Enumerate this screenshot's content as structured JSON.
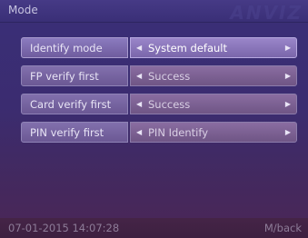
{
  "header": {
    "title": "Mode",
    "brand": "ANVIZ"
  },
  "settings": [
    {
      "label": "Identify mode",
      "value": "System default",
      "active": true
    },
    {
      "label": "FP verify first",
      "value": "Success",
      "active": false
    },
    {
      "label": "Card verify first",
      "value": "Success",
      "active": false
    },
    {
      "label": "PIN verify first",
      "value": "PIN Identify",
      "active": false
    }
  ],
  "footer": {
    "datetime": "07-01-2015 14:07:28",
    "back": "M/back"
  },
  "icons": {
    "left": "arrow-left-icon",
    "right": "arrow-right-icon"
  }
}
